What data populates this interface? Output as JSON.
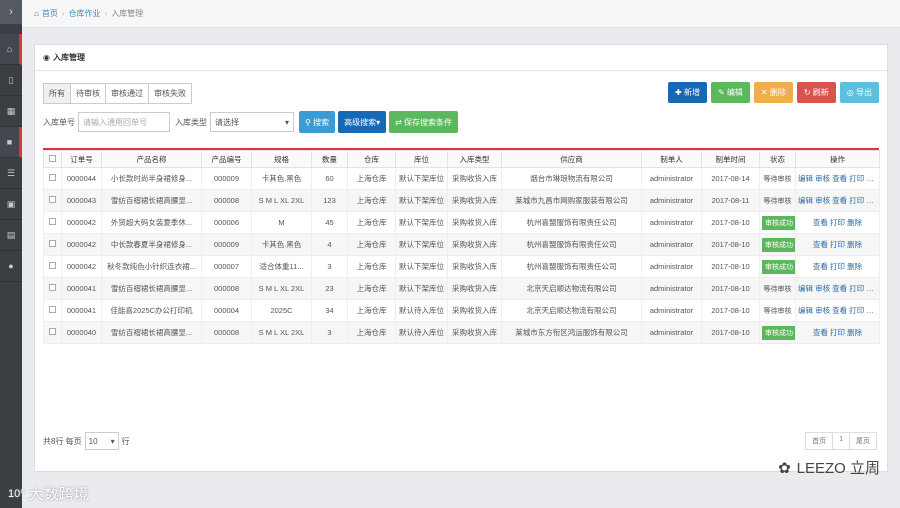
{
  "breadcrumb": {
    "home": "首页",
    "level1": "仓库作业",
    "level2": "入库管理"
  },
  "panel": {
    "title": "入库管理"
  },
  "tabs": [
    "所有",
    "待审核",
    "审核通过",
    "审核失败"
  ],
  "actions": {
    "add": "新增",
    "edit": "编辑",
    "delete": "删除",
    "refresh": "刷新",
    "export": "导出"
  },
  "filter": {
    "no_label": "入库单号",
    "no_placeholder": "请输入通用回单号",
    "type_label": "入库类型",
    "type_value": "请选择",
    "search": "搜索",
    "advanced": "高级搜索",
    "save": "保存搜索条件"
  },
  "table": {
    "headers": [
      "",
      "订单号",
      "产品名称",
      "产品编号",
      "规格",
      "数量",
      "仓库",
      "库位",
      "入库类型",
      "供应商",
      "制单人",
      "制单时间",
      "状态",
      "操作"
    ],
    "rows": [
      {
        "no": "0000044",
        "name": "小长款时尚半身裙修身...",
        "code": "000009",
        "spec": "卡其色.黑色",
        "qty": "60",
        "wh": "上海仓库",
        "loc": "默认下架库位",
        "type": "采购收货入库",
        "supplier": "烟台市琳琅物流有限公司",
        "creator": "administrator",
        "date": "2017-08-14",
        "status": "等待审核",
        "op": "编辑 审核 查看 打印 删除"
      },
      {
        "no": "0000043",
        "name": "雪纺百褶裙长裙高腰显...",
        "code": "000008",
        "spec": "S M L XL 2XL",
        "qty": "123",
        "wh": "上海仓库",
        "loc": "默认下架库位",
        "type": "采购收货入库",
        "supplier": "莱城市九昌市网购家服装有限公司",
        "creator": "administrator",
        "date": "2017-08-11",
        "status": "等待审核",
        "op": "编辑 审核 查看 打印 删除"
      },
      {
        "no": "0000042",
        "name": "外贸超大码女装夏季休...",
        "code": "000006",
        "spec": "M",
        "qty": "45",
        "wh": "上海仓库",
        "loc": "默认下架库位",
        "type": "采购收货入库",
        "supplier": "杭州喜盟服饰有限责任公司",
        "creator": "administrator",
        "date": "2017-08-10",
        "status": "审核成功",
        "op": "查看 打印 删除"
      },
      {
        "no": "0000042",
        "name": "中长款春夏半身裙修身...",
        "code": "000009",
        "spec": "卡其色.黑色",
        "qty": "4",
        "wh": "上海仓库",
        "loc": "默认下架库位",
        "type": "采购收货入库",
        "supplier": "杭州喜盟服饰有限责任公司",
        "creator": "administrator",
        "date": "2017-08-10",
        "status": "审核成功",
        "op": "查看 打印 删除"
      },
      {
        "no": "0000042",
        "name": "秋冬款纯色小针织连衣裙...",
        "code": "000007",
        "spec": "适合体重11...",
        "qty": "3",
        "wh": "上海仓库",
        "loc": "默认下架库位",
        "type": "采购收货入库",
        "supplier": "杭州喜盟服饰有限责任公司",
        "creator": "administrator",
        "date": "2017-08-10",
        "status": "审核成功",
        "op": "查看 打印 删除"
      },
      {
        "no": "0000041",
        "name": "雪纺百褶裙长裙高腰显...",
        "code": "000008",
        "spec": "S M L XL 2XL",
        "qty": "23",
        "wh": "上海仓库",
        "loc": "默认下架库位",
        "type": "采购收货入库",
        "supplier": "北京天启顺达物流有限公司",
        "creator": "administrator",
        "date": "2017-08-10",
        "status": "等待审核",
        "op": "编辑 审核 查看 打印 删除"
      },
      {
        "no": "0000041",
        "name": "佳能喜2025C办公打印机",
        "code": "000004",
        "spec": "2025C",
        "qty": "34",
        "wh": "上海仓库",
        "loc": "默认待入库位",
        "type": "采购收货入库",
        "supplier": "北京天启顺达物流有限公司",
        "creator": "administrator",
        "date": "2017-08-10",
        "status": "等待审核",
        "op": "编辑 审核 查看 打印 删除"
      },
      {
        "no": "0000040",
        "name": "雪纺百褶裙长裙高腰显...",
        "code": "000008",
        "spec": "S M L XL 2XL",
        "qty": "3",
        "wh": "上海仓库",
        "loc": "默认待入库位",
        "type": "采购收货入库",
        "supplier": "莱城市东方衔区鸿运服饰有限公司",
        "creator": "administrator",
        "date": "2017-08-10",
        "status": "审核成功",
        "op": "查看 打印 删除"
      }
    ]
  },
  "pagination": {
    "prefix": "共8行 每页",
    "page_size": "10",
    "suffix": "行",
    "first": "首页",
    "current": "1",
    "last": "尾页"
  },
  "watermark": {
    "left": "大数跨境",
    "right": "LEEZO 立周"
  }
}
